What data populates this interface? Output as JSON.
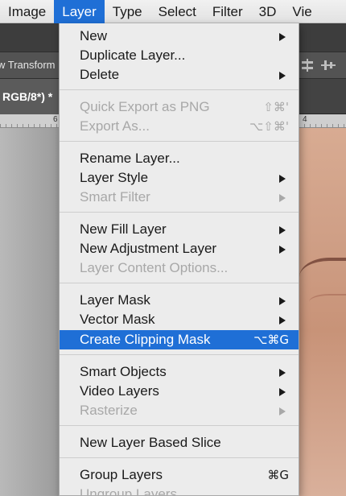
{
  "menubar": {
    "items": [
      "Image",
      "Layer",
      "Type",
      "Select",
      "Filter",
      "3D",
      "Vie"
    ]
  },
  "options_bar": {
    "label": "w Transform"
  },
  "document": {
    "tab_title": "RGB/8*) *"
  },
  "ruler": {
    "left_num": "6",
    "right_num": "4"
  },
  "layer_menu": {
    "groups": [
      [
        {
          "label": "New",
          "submenu": true
        },
        {
          "label": "Duplicate Layer..."
        },
        {
          "label": "Delete",
          "submenu": true
        }
      ],
      [
        {
          "label": "Quick Export as PNG",
          "shortcut": "⇧⌘'",
          "disabled": true
        },
        {
          "label": "Export As...",
          "shortcut": "⌥⇧⌘'",
          "disabled": true
        }
      ],
      [
        {
          "label": "Rename Layer..."
        },
        {
          "label": "Layer Style",
          "submenu": true
        },
        {
          "label": "Smart Filter",
          "submenu": true,
          "disabled": true
        }
      ],
      [
        {
          "label": "New Fill Layer",
          "submenu": true
        },
        {
          "label": "New Adjustment Layer",
          "submenu": true
        },
        {
          "label": "Layer Content Options...",
          "disabled": true
        }
      ],
      [
        {
          "label": "Layer Mask",
          "submenu": true
        },
        {
          "label": "Vector Mask",
          "submenu": true
        },
        {
          "label": "Create Clipping Mask",
          "shortcut": "⌥⌘G",
          "highlighted": true
        }
      ],
      [
        {
          "label": "Smart Objects",
          "submenu": true
        },
        {
          "label": "Video Layers",
          "submenu": true
        },
        {
          "label": "Rasterize",
          "submenu": true,
          "disabled": true
        }
      ],
      [
        {
          "label": "New Layer Based Slice"
        }
      ],
      [
        {
          "label": "Group Layers",
          "shortcut": "⌘G"
        },
        {
          "label": "Ungroup Layers",
          "disabled": true
        }
      ]
    ]
  },
  "colors": {
    "highlight": "#1f6fd6",
    "menu_bg": "#ececec",
    "disabled_text": "#a8a8a8"
  }
}
